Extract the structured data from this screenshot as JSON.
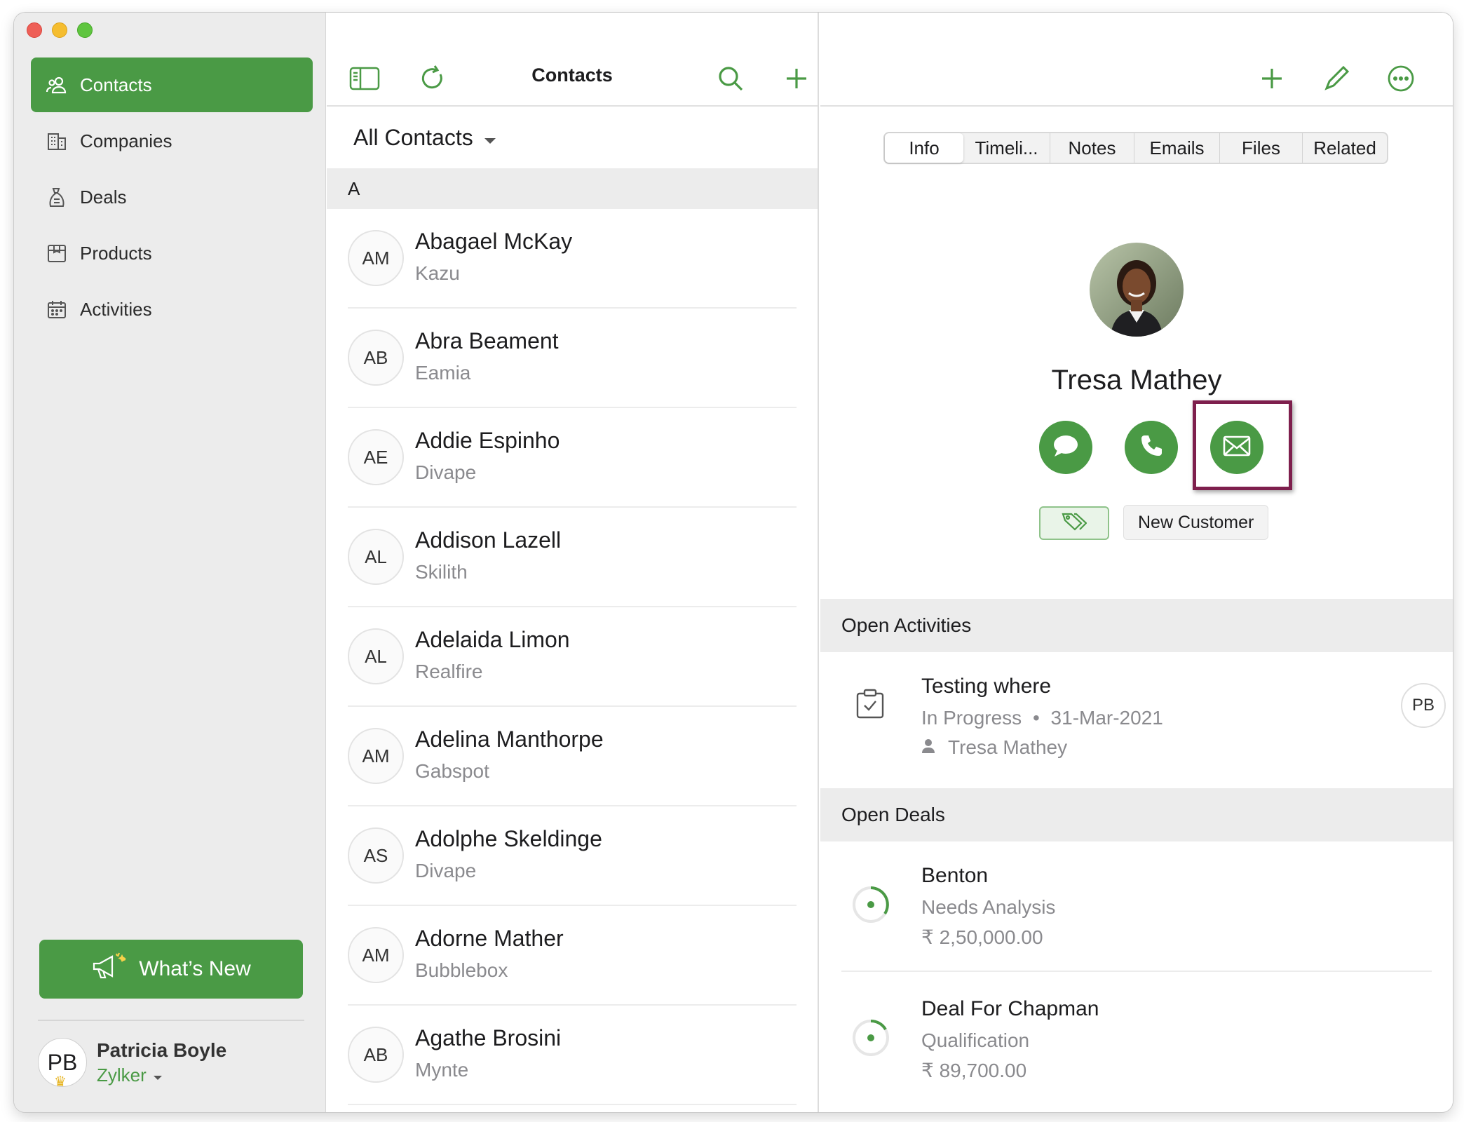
{
  "sidebar": {
    "items": [
      {
        "label": "Contacts",
        "icon": "contacts-icon",
        "active": true
      },
      {
        "label": "Companies",
        "icon": "companies-icon",
        "active": false
      },
      {
        "label": "Deals",
        "icon": "deals-icon",
        "active": false
      },
      {
        "label": "Products",
        "icon": "products-icon",
        "active": false
      },
      {
        "label": "Activities",
        "icon": "activities-icon",
        "active": false
      }
    ],
    "whats_new_label": "What’s New",
    "user": {
      "initials": "PB",
      "name": "Patricia Boyle",
      "org": "Zylker"
    }
  },
  "list": {
    "title": "Contacts",
    "filter_label": "All Contacts",
    "section_letter": "A",
    "contacts": [
      {
        "initials": "AM",
        "name": "Abagael McKay",
        "company": "Kazu"
      },
      {
        "initials": "AB",
        "name": "Abra Beament",
        "company": "Eamia"
      },
      {
        "initials": "AE",
        "name": "Addie Espinho",
        "company": "Divape"
      },
      {
        "initials": "AL",
        "name": "Addison Lazell",
        "company": "Skilith"
      },
      {
        "initials": "AL",
        "name": "Adelaida Limon",
        "company": "Realfire"
      },
      {
        "initials": "AM",
        "name": "Adelina Manthorpe",
        "company": "Gabspot"
      },
      {
        "initials": "AS",
        "name": "Adolphe Skeldinge",
        "company": "Divape"
      },
      {
        "initials": "AM",
        "name": "Adorne Mather",
        "company": "Bubblebox"
      },
      {
        "initials": "AB",
        "name": "Agathe Brosini",
        "company": "Mynte"
      }
    ]
  },
  "detail": {
    "tabs": [
      "Info",
      "Timeli...",
      "Notes",
      "Emails",
      "Files",
      "Related"
    ],
    "active_tab": "Info",
    "contact_name": "Tresa Mathey",
    "tag_label": "New Customer",
    "open_activities": {
      "header": "Open Activities",
      "items": [
        {
          "title": "Testing where",
          "status": "In Progress",
          "date": "31-Mar-2021",
          "related": "Tresa Mathey",
          "owner_initials": "PB"
        }
      ]
    },
    "open_deals": {
      "header": "Open Deals",
      "items": [
        {
          "title": "Benton",
          "stage": "Needs Analysis",
          "amount": "₹ 2,50,000.00"
        },
        {
          "title": "Deal For Chapman",
          "stage": "Qualification",
          "amount": "₹ 89,700.00"
        }
      ]
    }
  },
  "colors": {
    "accent": "#4a9a45",
    "highlight": "#7e1f4d"
  }
}
